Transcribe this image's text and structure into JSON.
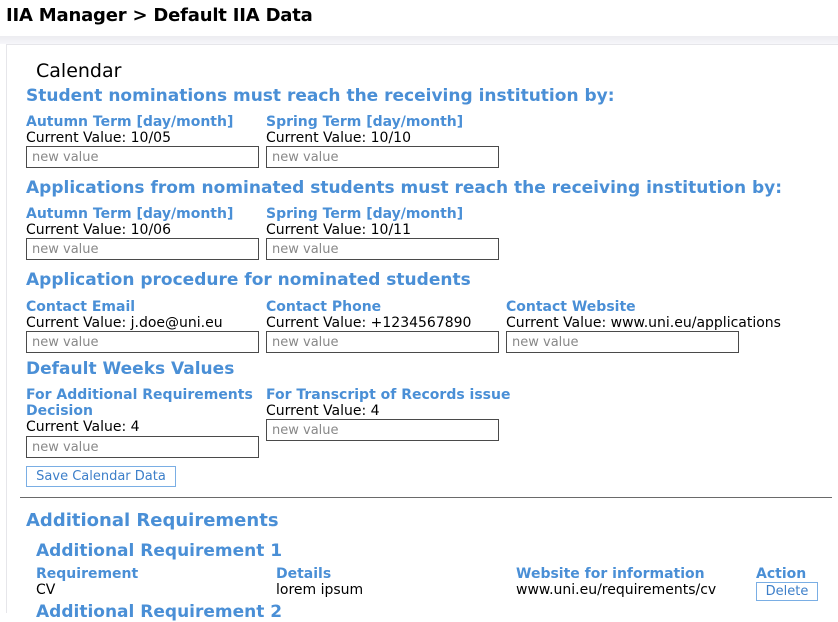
{
  "header": {
    "breadcrumb": "IIA Manager > Default IIA Data"
  },
  "calendar": {
    "title": "Calendar",
    "nominations": {
      "heading": "Student nominations must reach the receiving institution by:",
      "autumn": {
        "label": "Autumn Term [day/month]",
        "current": "Current Value: 10/05",
        "placeholder": "new value"
      },
      "spring": {
        "label": "Spring Term [day/month]",
        "current": "Current Value: 10/10",
        "placeholder": "new value"
      }
    },
    "applications": {
      "heading": "Applications from nominated students must reach the receiving institution by:",
      "autumn": {
        "label": "Autumn Term [day/month]",
        "current": "Current Value: 10/06",
        "placeholder": "new value"
      },
      "spring": {
        "label": "Spring Term [day/month]",
        "current": "Current Value: 10/11",
        "placeholder": "new value"
      }
    },
    "procedure": {
      "heading": "Application procedure for nominated students",
      "email": {
        "label": "Contact Email",
        "current": "Current Value: j.doe@uni.eu",
        "placeholder": "new value"
      },
      "phone": {
        "label": "Contact Phone",
        "current": "Current Value: +1234567890",
        "placeholder": "new value"
      },
      "website": {
        "label": "Contact Website",
        "current": "Current Value: www.uni.eu/applications",
        "placeholder": "new value"
      }
    },
    "weeks": {
      "heading": "Default Weeks Values",
      "additional": {
        "label_line1": "For Additional Requirements",
        "label_line2": "Decision",
        "current": "Current Value: 4",
        "placeholder": "new value"
      },
      "transcript": {
        "label": "For Transcript of Records issue",
        "current": "Current Value: 4",
        "placeholder": "new value"
      }
    },
    "save_label": "Save Calendar Data"
  },
  "additional_requirements": {
    "heading": "Additional Requirements",
    "items": [
      {
        "title": "Additional Requirement 1",
        "col_requirement": "Requirement",
        "col_details": "Details",
        "col_website": "Website for information",
        "col_action": "Action",
        "requirement": "CV",
        "details": "lorem ipsum",
        "website": "www.uni.eu/requirements/cv",
        "delete_label": "Delete"
      }
    ],
    "next_title": "Additional Requirement 2"
  }
}
